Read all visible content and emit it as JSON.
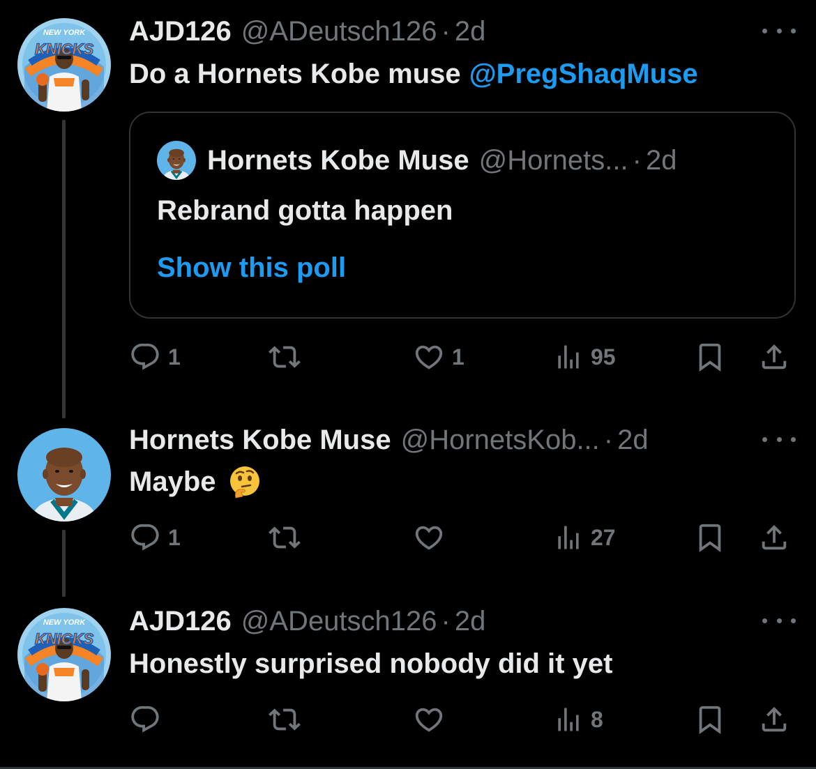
{
  "tweets": [
    {
      "name": "AJD126",
      "handle": "@ADeutsch126",
      "separator": "·",
      "time": "2d",
      "text": "Do a Hornets Kobe muse",
      "mention": "@PregShaqMuse",
      "quote": {
        "name": "Hornets Kobe Muse",
        "handle": "@Hornets...",
        "separator": "·",
        "time": "2d",
        "text": "Rebrand gotta happen",
        "poll_link": "Show this poll"
      },
      "actions": {
        "replies": "1",
        "reposts": "",
        "likes": "1",
        "views": "95"
      }
    },
    {
      "name": "Hornets Kobe Muse",
      "handle": "@HornetsKob...",
      "separator": "·",
      "time": "2d",
      "text": "Maybe",
      "emoji": "thinking-face-emoji",
      "actions": {
        "replies": "1",
        "reposts": "",
        "likes": "",
        "views": "27"
      }
    },
    {
      "name": "AJD126",
      "handle": "@ADeutsch126",
      "separator": "·",
      "time": "2d",
      "text": "Honestly surprised nobody did it yet",
      "actions": {
        "replies": "",
        "reposts": "",
        "likes": "",
        "views": "8"
      }
    }
  ],
  "avatar_texts": {
    "knicks_top": "NEW YORK",
    "knicks_main": "KNICKS"
  },
  "colors": {
    "background": "#000000",
    "text": "#e7e9ea",
    "muted": "#71767b",
    "link": "#1d9bf0",
    "border": "#2f3336"
  },
  "icons": {
    "reply": "reply-icon",
    "repost": "repost-icon",
    "like": "heart-icon",
    "views": "views-icon",
    "bookmark": "bookmark-icon",
    "share": "share-icon",
    "more": "more-icon"
  }
}
